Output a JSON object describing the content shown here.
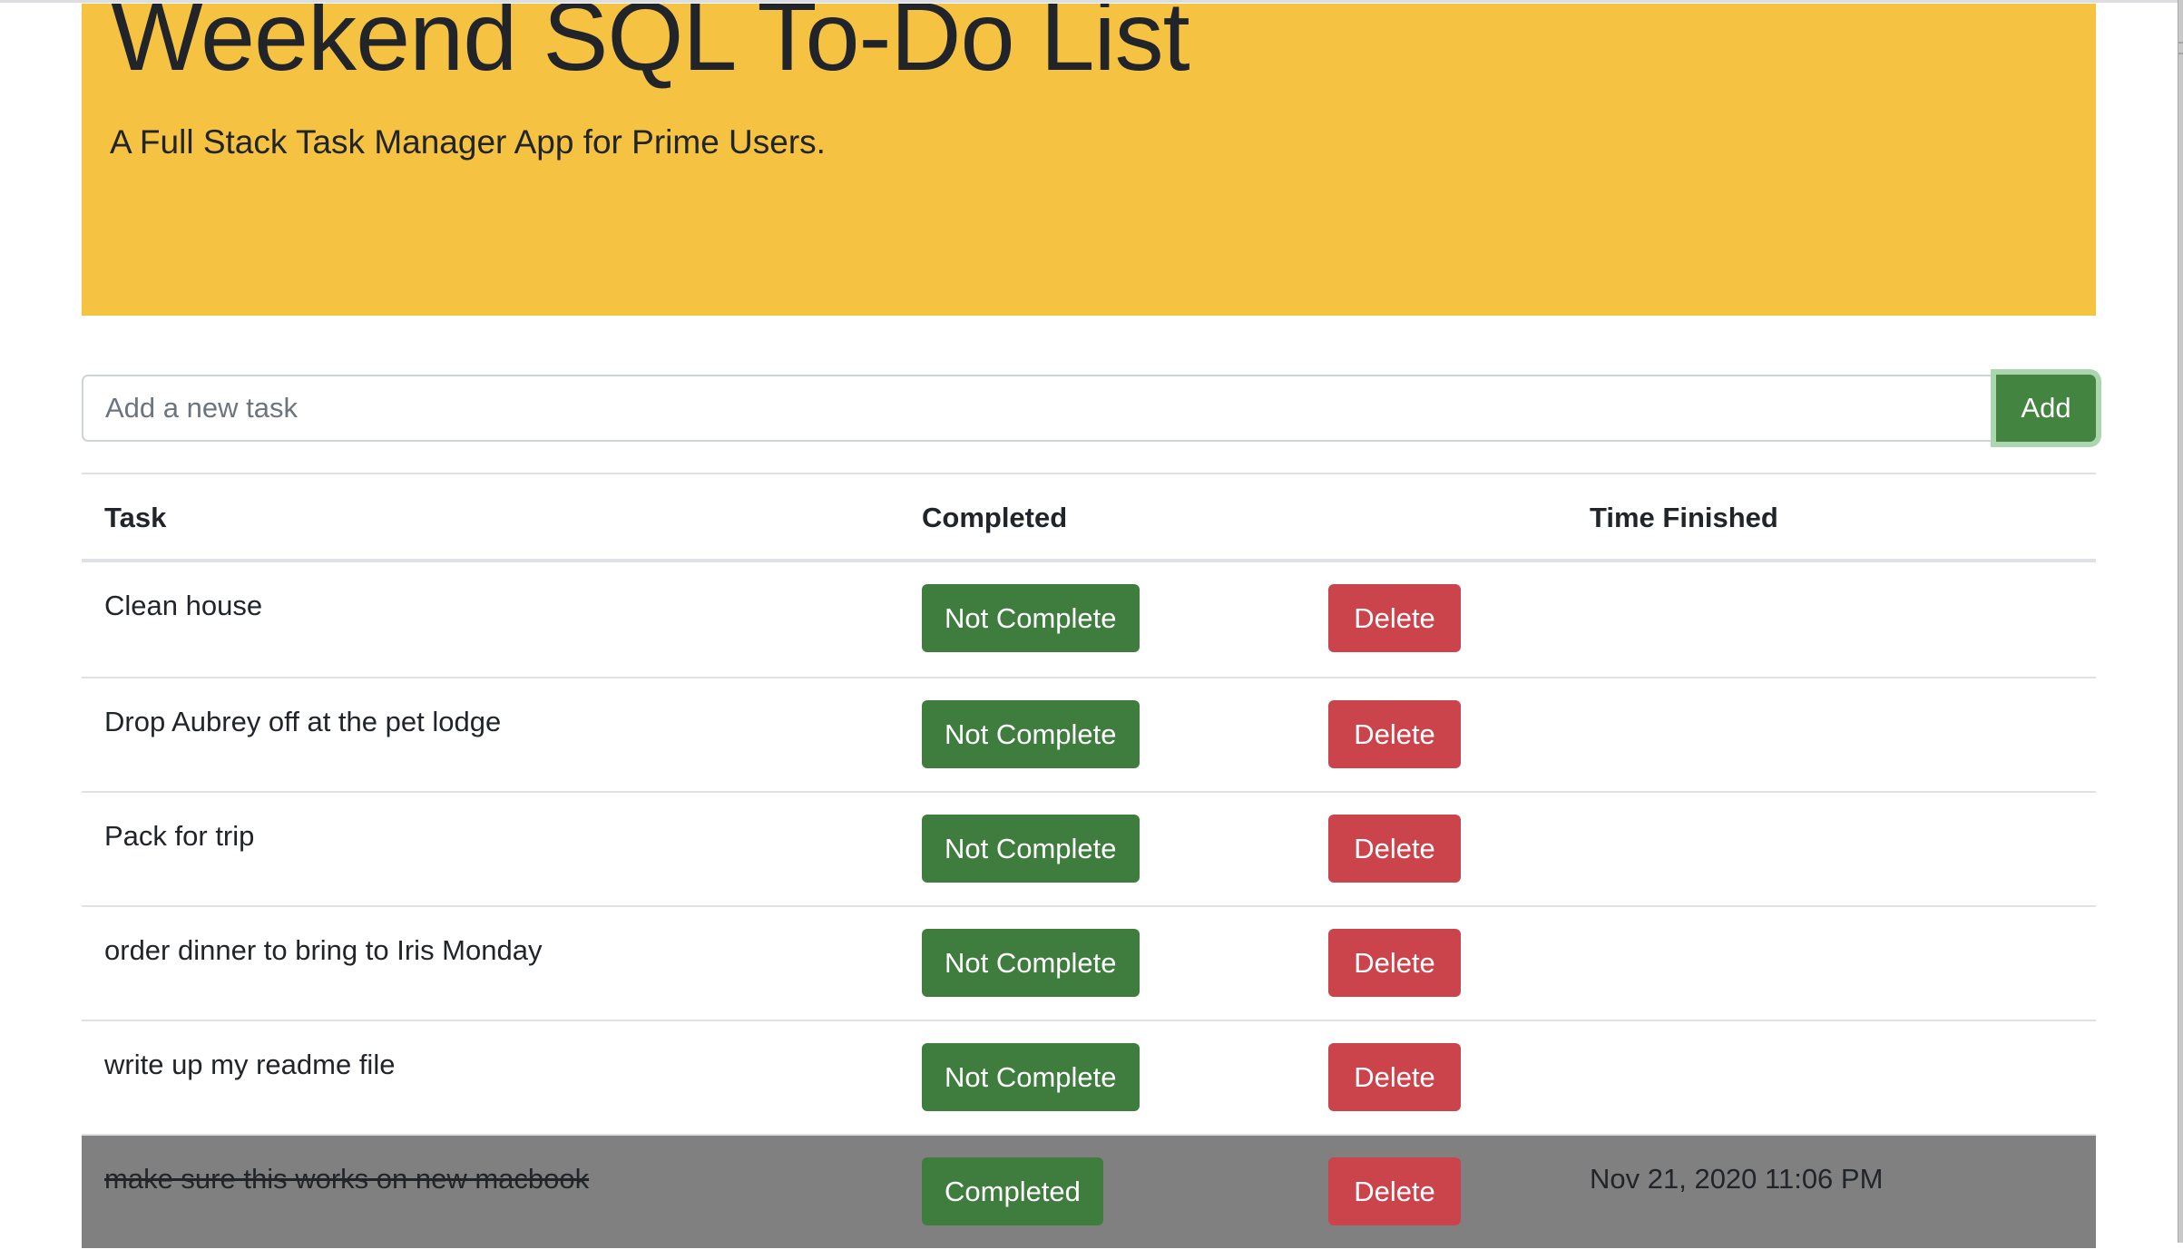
{
  "header": {
    "title": "Weekend SQL To-Do List",
    "subtitle": "A Full Stack Task Manager App for Prime Users."
  },
  "form": {
    "input_value": "",
    "input_placeholder": "Add a new task",
    "add_label": "Add"
  },
  "table": {
    "columns": [
      "Task",
      "Completed",
      "",
      "Time Finished"
    ],
    "rows": [
      {
        "task": "Clean house",
        "status_label": "Not Complete",
        "delete_label": "Delete",
        "time_finished": "",
        "completed": false
      },
      {
        "task": "Drop Aubrey off at the pet lodge",
        "status_label": "Not Complete",
        "delete_label": "Delete",
        "time_finished": "",
        "completed": false
      },
      {
        "task": "Pack for trip",
        "status_label": "Not Complete",
        "delete_label": "Delete",
        "time_finished": "",
        "completed": false
      },
      {
        "task": "order dinner to bring to Iris Monday",
        "status_label": "Not Complete",
        "delete_label": "Delete",
        "time_finished": "",
        "completed": false
      },
      {
        "task": "write up my readme file",
        "status_label": "Not Complete",
        "delete_label": "Delete",
        "time_finished": "",
        "completed": false
      },
      {
        "task": "make sure this works on new macbook",
        "status_label": "Completed",
        "delete_label": "Delete",
        "time_finished": "Nov 21, 2020 11:06 PM",
        "completed": true
      }
    ]
  },
  "colors": {
    "jumbotron": "#f5c242",
    "success": "#3f7d3f",
    "danger": "#cc444b",
    "completed_row": "#808080"
  }
}
